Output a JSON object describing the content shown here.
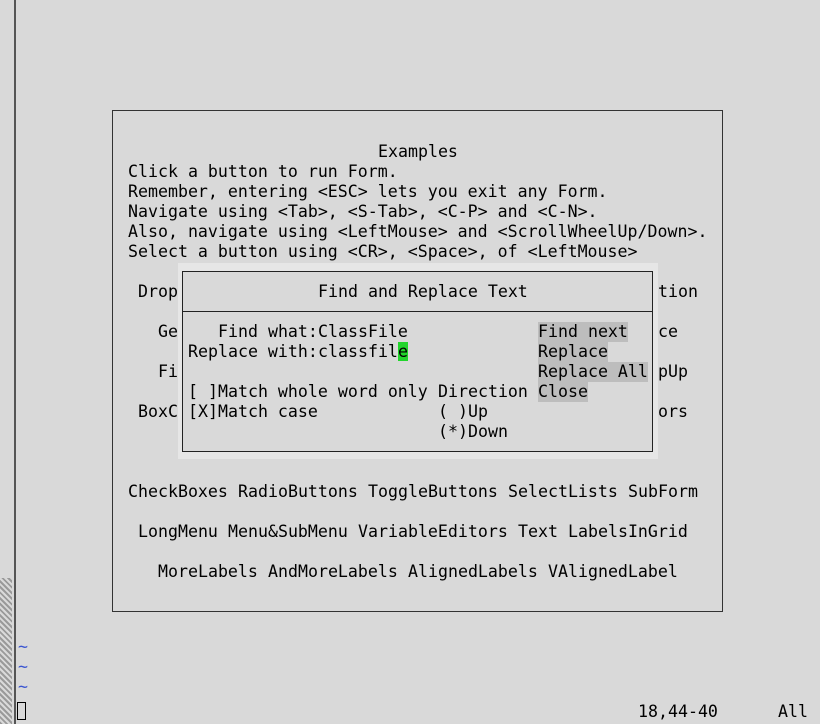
{
  "panel": {
    "title": "Examples",
    "lines": [
      "Click a button to run Form.",
      "Remember, entering <ESC> lets you exit any Form.",
      "Navigate using <Tab>, <S-Tab>, <C-P> and <C-N>.",
      "Also, navigate using <LeftMouse> and <ScrollWheelUp/Down>.",
      "Select a button using <CR>, <Space>, of <LeftMouse>"
    ],
    "partial_left": [
      "Drop",
      "Ge",
      "Fi",
      "BoxC"
    ],
    "partial_right": [
      "tion",
      "ce",
      "pUp",
      "ors"
    ],
    "button_rows": [
      [
        "CheckBoxes",
        "RadioButtons",
        "ToggleButtons",
        "SelectLists",
        "SubForm"
      ],
      [
        "LongMenu",
        "Menu&SubMenu",
        "VariableEditors",
        "Text",
        "LabelsInGrid"
      ],
      [
        "MoreLabels",
        "AndMoreLabels",
        "AlignedLabels",
        "VAlignedLabel"
      ]
    ]
  },
  "dialog": {
    "title": "Find and Replace Text",
    "find_label": "Find what:",
    "find_value": "ClassFile",
    "replace_label": "Replace with:",
    "replace_value": "classfil",
    "replace_cursor_char": "e",
    "whole_word": {
      "box": "[ ]",
      "label": "Match whole word only"
    },
    "match_case": {
      "box": "[X]",
      "label": "Match case"
    },
    "direction_label": "Direction",
    "direction_up": "( )Up",
    "direction_down": "(*)Down",
    "buttons": {
      "find_next": "Find next",
      "replace": "Replace",
      "replace_all": "Replace All",
      "close": "Close"
    }
  },
  "vim": {
    "tilde": "~",
    "position": "18,44-40",
    "scroll": "All"
  },
  "colors": {
    "background": "#d9d9d9",
    "cursor": "#22d52c",
    "button": "#bdbdbd",
    "tilde": "#3a55d0"
  }
}
